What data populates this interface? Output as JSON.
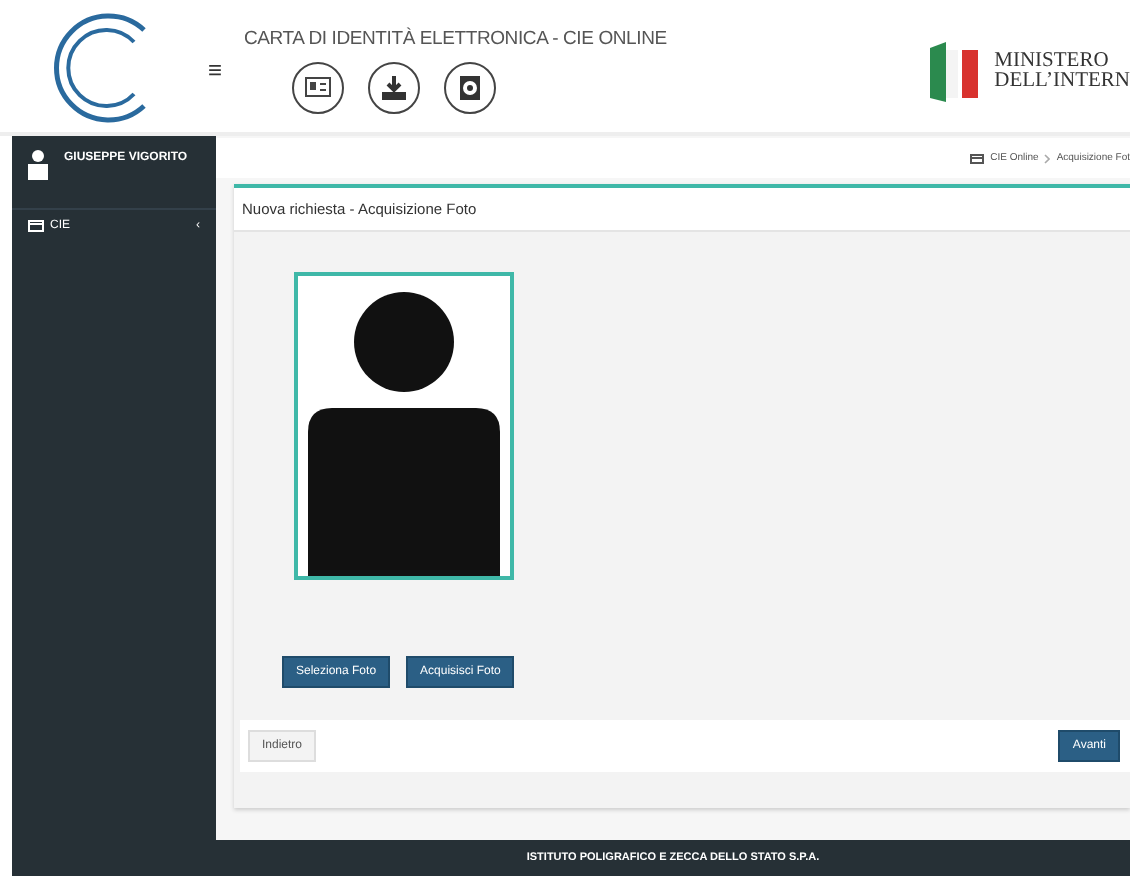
{
  "header": {
    "title": "CARTA DI IDENTITÀ ELETTRONICA - CIE ONLINE",
    "menu_toggle": "≡",
    "ministry": [
      "MINISTERO",
      "DELL’INTERN"
    ]
  },
  "sidebar": {
    "user": "GIUSEPPE VIGORITO",
    "items": [
      {
        "label": "CIE",
        "chevron": "‹",
        "expanded": false
      }
    ]
  },
  "breadcrumb": [
    "CIE Online",
    "Acquisizione Fot"
  ],
  "panel": {
    "title": "Nuova richiesta - Acquisizione Foto",
    "buttons": [
      "Seleziona Foto",
      "Acquisisci Foto"
    ],
    "back": "Indietro",
    "next": "Avanti"
  },
  "footer": "ISTITUTO POLIGRAFICO E ZECCA DELLO STATO S.P.A."
}
